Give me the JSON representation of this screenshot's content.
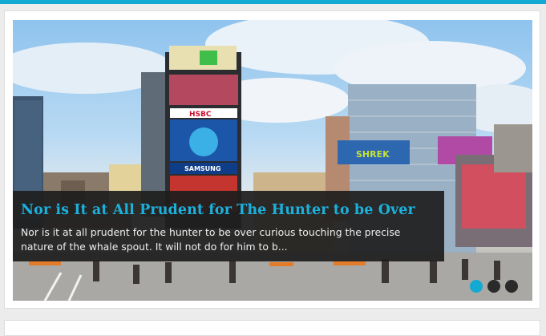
{
  "slider": {
    "slide_image_alt": "Times Square street scene",
    "billboards": {
      "hsbc": "HSBC",
      "samsung": "SAMSUNG",
      "shrek": "SHREK"
    },
    "caption": {
      "title": "Nor is It at All Prudent for The Hunter to be Over",
      "text": "Nor is it at all prudent for the hunter to be over curious touching the precise nature of the whale spout. It will not do for him to b..."
    },
    "pagination": [
      {
        "label": "Slide 1",
        "active": true
      },
      {
        "label": "Slide 2",
        "active": false
      },
      {
        "label": "Slide 3",
        "active": false
      }
    ]
  },
  "colors": {
    "accent": "#12a9d3",
    "caption_bg": "#1e1e1e",
    "page_bg": "#ececec"
  }
}
